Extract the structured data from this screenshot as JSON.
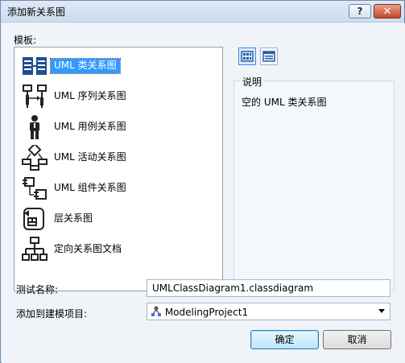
{
  "window": {
    "title": "添加新关系图",
    "help_label": "?",
    "close_label": "✕"
  },
  "templates_label": "模板:",
  "templates": [
    {
      "name": "UML 类关系图",
      "icon": "class-diagram-icon",
      "selected": true
    },
    {
      "name": "UML 序列关系图",
      "icon": "sequence-diagram-icon",
      "selected": false
    },
    {
      "name": "UML 用例关系图",
      "icon": "use-case-diagram-icon",
      "selected": false
    },
    {
      "name": "UML 活动关系图",
      "icon": "activity-diagram-icon",
      "selected": false
    },
    {
      "name": "UML 组件关系图",
      "icon": "component-diagram-icon",
      "selected": false
    },
    {
      "name": "层关系图",
      "icon": "layer-diagram-icon",
      "selected": false
    },
    {
      "name": "定向关系图文档",
      "icon": "directed-graph-icon",
      "selected": false
    }
  ],
  "view_toggle": {
    "large_icons": "large-icons-view-icon",
    "list": "list-view-icon"
  },
  "description": {
    "title": "说明",
    "text": "空的 UML 类关系图"
  },
  "form": {
    "name_label": "测试名称:",
    "name_value": "UMLClassDiagram1.classdiagram",
    "project_label": "添加到建模项目:",
    "project_value": "ModelingProject1",
    "project_icon": "modeling-project-icon"
  },
  "buttons": {
    "ok": "确定",
    "cancel": "取消"
  },
  "colors": {
    "selection": "#3399ff",
    "title_bar": "#cddcee",
    "close_button": "#c5462a"
  }
}
